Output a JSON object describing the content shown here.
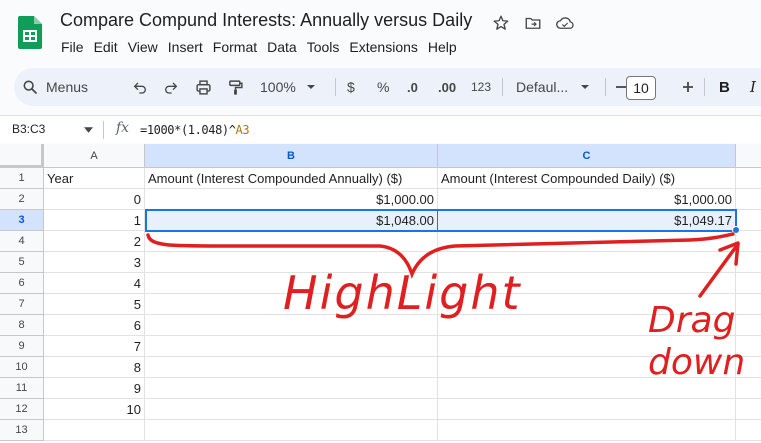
{
  "app": {
    "title": "Compare Compund Interests: Annually versus Daily",
    "menu": [
      "File",
      "Edit",
      "View",
      "Insert",
      "Format",
      "Data",
      "Tools",
      "Extensions",
      "Help"
    ]
  },
  "toolbar": {
    "menus_label": "Menus",
    "zoom": "100%",
    "currency": "$",
    "percent": "%",
    "decrease_decimal": ".0",
    "increase_decimal": ".00",
    "number_format": "123",
    "font": "Defaul...",
    "font_size": "10",
    "bold": "B",
    "italic": "I"
  },
  "formula_bar": {
    "name_box": "B3:C3",
    "fx": "fx",
    "formula_main": "=1000*(1.048)^",
    "formula_ref": "A3"
  },
  "sheet": {
    "columns": [
      "A",
      "B",
      "C"
    ],
    "rows": [
      {
        "n": "1",
        "a": "Year",
        "b": "Amount (Interest Compounded Annually) ($)",
        "c": "Amount (Interest Compounded Daily) ($)"
      },
      {
        "n": "2",
        "a": "0",
        "b": "$1,000.00",
        "c": "$1,000.00"
      },
      {
        "n": "3",
        "a": "1",
        "b": "$1,048.00",
        "c": "$1,049.17"
      },
      {
        "n": "4",
        "a": "2",
        "b": "",
        "c": ""
      },
      {
        "n": "5",
        "a": "3",
        "b": "",
        "c": ""
      },
      {
        "n": "6",
        "a": "4",
        "b": "",
        "c": ""
      },
      {
        "n": "7",
        "a": "5",
        "b": "",
        "c": ""
      },
      {
        "n": "8",
        "a": "6",
        "b": "",
        "c": ""
      },
      {
        "n": "9",
        "a": "7",
        "b": "",
        "c": ""
      },
      {
        "n": "10",
        "a": "8",
        "b": "",
        "c": ""
      },
      {
        "n": "11",
        "a": "9",
        "b": "",
        "c": ""
      },
      {
        "n": "12",
        "a": "10",
        "b": "",
        "c": ""
      },
      {
        "n": "13",
        "a": "",
        "b": "",
        "c": ""
      }
    ]
  },
  "annotations": {
    "highlight": "HighLight",
    "drag_line1": "Drag",
    "drag_line2": "down",
    "color": "#e02020"
  },
  "colors": {
    "accent": "#1a73e8",
    "sheets_green": "#0f9d58"
  }
}
